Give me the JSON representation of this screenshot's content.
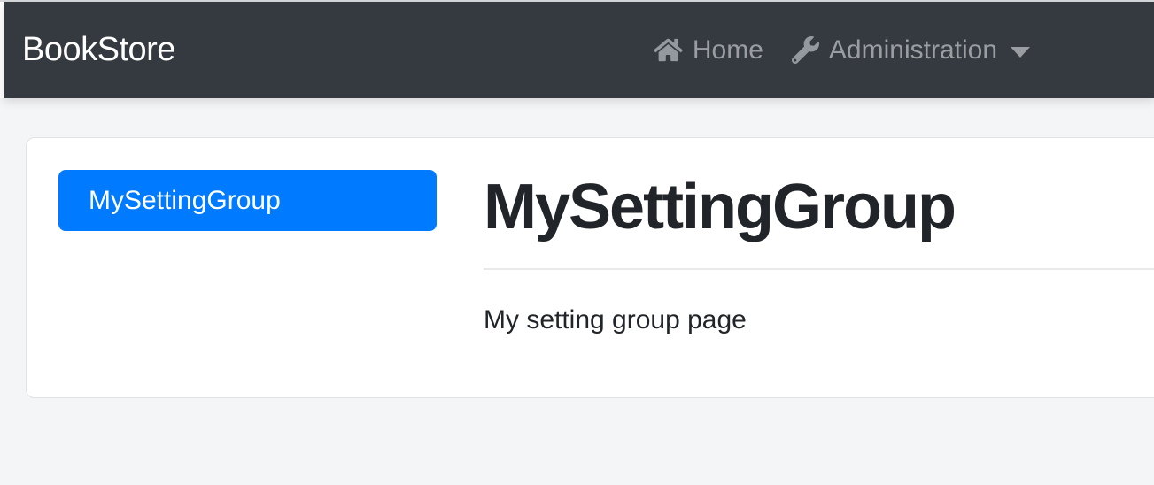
{
  "navbar": {
    "brand": "BookStore",
    "items": [
      {
        "label": "Home",
        "icon": "home-icon"
      },
      {
        "label": "Administration",
        "icon": "wrench-icon",
        "has_caret": true
      }
    ]
  },
  "settings": {
    "nav": [
      {
        "label": "MySettingGroup",
        "active": true
      }
    ],
    "panel": {
      "title": "MySettingGroup",
      "body": "My setting group page"
    }
  },
  "colors": {
    "navbar_bg": "#343a40",
    "page_bg": "#f4f5f7",
    "card_bg": "#ffffff",
    "card_border": "#dfe2e6",
    "primary": "#007bff",
    "nav_link_text": "#9a9ea3",
    "heading_text": "#212529",
    "divider": "#e8e9eb"
  }
}
